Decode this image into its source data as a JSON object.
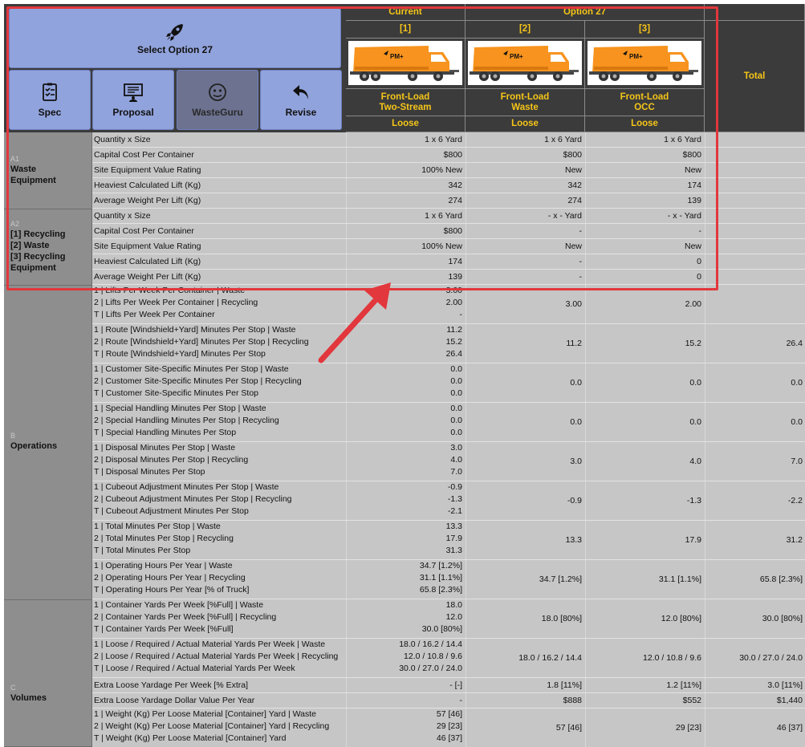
{
  "toolbar": {
    "select_label": "Select Option 27",
    "spec_label": "Spec",
    "proposal_label": "Proposal",
    "wasteguru_label": "WasteGuru",
    "revise_label": "Revise"
  },
  "header": {
    "current_label": "Current",
    "option_label": "Option 27",
    "total_label": "Total",
    "columns": [
      {
        "index": "[1]",
        "service_line1": "Front-Load",
        "service_line2": "Two-Stream",
        "material": "Loose"
      },
      {
        "index": "[2]",
        "service_line1": "Front-Load",
        "service_line2": "Waste",
        "material": "Loose"
      },
      {
        "index": "[3]",
        "service_line1": "Front-Load",
        "service_line2": "OCC",
        "material": "Loose"
      }
    ],
    "truck_logo_text": "PM+"
  },
  "sections": [
    {
      "code": "A1",
      "name_lines": [
        "Waste",
        "Equipment"
      ]
    },
    {
      "code": "A2",
      "name_lines": [
        "[1] Recycling",
        "[2] Waste",
        "[3] Recycling",
        "Equipment"
      ]
    },
    {
      "code": "B",
      "name_lines": [
        "Operations"
      ]
    },
    {
      "code": "C",
      "name_lines": [
        "Volumes"
      ]
    }
  ],
  "rows": [
    {
      "labels": [
        "Quantity x Size"
      ],
      "cur": [
        "1 x 6 Yard"
      ],
      "o2": "1 x 6 Yard",
      "o3": "1 x 6 Yard",
      "tot": ""
    },
    {
      "labels": [
        "Capital Cost Per Container"
      ],
      "cur": [
        "$800"
      ],
      "o2": "$800",
      "o3": "$800",
      "tot": ""
    },
    {
      "labels": [
        "Site Equipment Value Rating"
      ],
      "cur": [
        "100% New"
      ],
      "o2": "New",
      "o3": "New",
      "tot": ""
    },
    {
      "labels": [
        "Heaviest Calculated Lift (Kg)"
      ],
      "cur": [
        "342"
      ],
      "o2": "342",
      "o3": "174",
      "tot": ""
    },
    {
      "labels": [
        "Average Weight Per Lift (Kg)"
      ],
      "cur": [
        "274"
      ],
      "o2": "274",
      "o3": "139",
      "tot": ""
    },
    {
      "labels": [
        "Quantity x Size"
      ],
      "cur": [
        "1 x 6 Yard"
      ],
      "o2": "- x - Yard",
      "o3": "- x - Yard",
      "tot": ""
    },
    {
      "labels": [
        "Capital Cost Per Container"
      ],
      "cur": [
        "$800"
      ],
      "o2": "-",
      "o3": "-",
      "tot": ""
    },
    {
      "labels": [
        "Site Equipment Value Rating"
      ],
      "cur": [
        "100% New"
      ],
      "o2": "New",
      "o3": "New",
      "tot": ""
    },
    {
      "labels": [
        "Heaviest Calculated Lift (Kg)"
      ],
      "cur": [
        "174"
      ],
      "o2": "-",
      "o3": "0",
      "tot": ""
    },
    {
      "labels": [
        "Average Weight Per Lift (Kg)"
      ],
      "cur": [
        "139"
      ],
      "o2": "-",
      "o3": "0",
      "tot": ""
    },
    {
      "labels": [
        "1 | Lifts Per Week Per Container | Waste",
        "2 | Lifts Per Week Per Container | Recycling",
        "T | Lifts Per Week Per Container"
      ],
      "cur": [
        "3.00",
        "2.00",
        "-"
      ],
      "o2": "3.00",
      "o3": "2.00",
      "tot": ""
    },
    {
      "labels": [
        "1 | Route [Windshield+Yard] Minutes Per Stop | Waste",
        "2 | Route [Windshield+Yard] Minutes Per Stop | Recycling",
        "T | Route [Windshield+Yard] Minutes Per Stop"
      ],
      "cur": [
        "11.2",
        "15.2",
        "26.4"
      ],
      "o2": "11.2",
      "o3": "15.2",
      "tot": "26.4"
    },
    {
      "labels": [
        "1 | Customer Site-Specific Minutes Per Stop | Waste",
        "2 | Customer Site-Specific Minutes Per Stop | Recycling",
        "T | Customer Site-Specific Minutes Per Stop"
      ],
      "cur": [
        "0.0",
        "0.0",
        "0.0"
      ],
      "o2": "0.0",
      "o3": "0.0",
      "tot": "0.0"
    },
    {
      "labels": [
        "1 | Special Handling Minutes Per Stop | Waste",
        "2 | Special Handling Minutes Per Stop | Recycling",
        "T | Special Handling Minutes Per Stop"
      ],
      "cur": [
        "0.0",
        "0.0",
        "0.0"
      ],
      "o2": "0.0",
      "o3": "0.0",
      "tot": "0.0"
    },
    {
      "labels": [
        "1 | Disposal Minutes Per Stop | Waste",
        "2 | Disposal Minutes Per Stop | Recycling",
        "T | Disposal Minutes Per Stop"
      ],
      "cur": [
        "3.0",
        "4.0",
        "7.0"
      ],
      "o2": "3.0",
      "o3": "4.0",
      "tot": "7.0"
    },
    {
      "labels": [
        "1 | Cubeout Adjustment Minutes Per Stop | Waste",
        "2 | Cubeout Adjustment Minutes Per Stop | Recycling",
        "T | Cubeout Adjustment Minutes Per Stop"
      ],
      "cur": [
        "-0.9",
        "-1.3",
        "-2.1"
      ],
      "o2": "-0.9",
      "o3": "-1.3",
      "tot": "-2.2"
    },
    {
      "labels": [
        "1 | Total Minutes Per Stop | Waste",
        "2 | Total Minutes Per Stop | Recycling",
        "T | Total Minutes Per Stop"
      ],
      "cur": [
        "13.3",
        "17.9",
        "31.3"
      ],
      "o2": "13.3",
      "o3": "17.9",
      "tot": "31.2"
    },
    {
      "labels": [
        "1 | Operating Hours Per Year | Waste",
        "2 | Operating Hours Per Year | Recycling",
        "T | Operating Hours Per Year [% of Truck]"
      ],
      "cur": [
        "34.7 [1.2%]",
        "31.1 [1.1%]",
        "65.8 [2.3%]"
      ],
      "o2": "34.7 [1.2%]",
      "o3": "31.1 [1.1%]",
      "tot": "65.8 [2.3%]"
    },
    {
      "labels": [
        "1 | Container Yards Per Week [%Full] | Waste",
        "2 | Container Yards Per Week [%Full] | Recycling",
        "T | Container Yards Per Week [%Full]"
      ],
      "cur": [
        "18.0",
        "12.0",
        "30.0 [80%]"
      ],
      "o2": "18.0 [80%]",
      "o3": "12.0 [80%]",
      "tot": "30.0 [80%]"
    },
    {
      "labels": [
        "1 | Loose / Required / Actual Material Yards Per Week | Waste",
        "2 | Loose / Required / Actual Material Yards Per Week | Recycling",
        "T | Loose / Required / Actual Material Yards Per Week"
      ],
      "cur": [
        "18.0 / 16.2 / 14.4",
        "12.0 / 10.8 / 9.6",
        "30.0 / 27.0 / 24.0"
      ],
      "o2": "18.0 / 16.2 / 14.4",
      "o3": "12.0 / 10.8 / 9.6",
      "tot": "30.0 / 27.0 / 24.0"
    },
    {
      "labels": [
        "Extra Loose Yardage Per Week [% Extra]"
      ],
      "cur": [
        "- [-]"
      ],
      "o2": "1.8 [11%]",
      "o3": "1.2 [11%]",
      "tot": "3.0 [11%]"
    },
    {
      "labels": [
        "Extra Loose Yardage Dollar Value Per Year"
      ],
      "cur": [
        "-"
      ],
      "o2": "$888",
      "o3": "$552",
      "tot": "$1,440"
    },
    {
      "labels": [
        "1 | Weight (Kg) Per Loose Material [Container] Yard | Waste",
        "2 | Weight (Kg) Per Loose Material [Container] Yard | Recycling",
        "T | Weight (Kg) Per Loose Material [Container] Yard"
      ],
      "cur": [
        "57 [46]",
        "29 [23]",
        "46 [37]"
      ],
      "o2": "57 [46]",
      "o3": "29 [23]",
      "tot": "46 [37]"
    }
  ],
  "colors": {
    "header_bg": "#3b3b3b",
    "header_text": "#f5c518",
    "button_bg": "#91a3dc",
    "body_bg": "#c6c6c6",
    "section_bg": "#8e8e8e",
    "highlight": "#e2373c",
    "truck_orange": "#f7931e"
  },
  "icons": {
    "select": "rocket-icon",
    "spec": "checklist-icon",
    "proposal": "presentation-icon",
    "wasteguru": "face-icon",
    "revise": "undo-arrow-icon"
  }
}
